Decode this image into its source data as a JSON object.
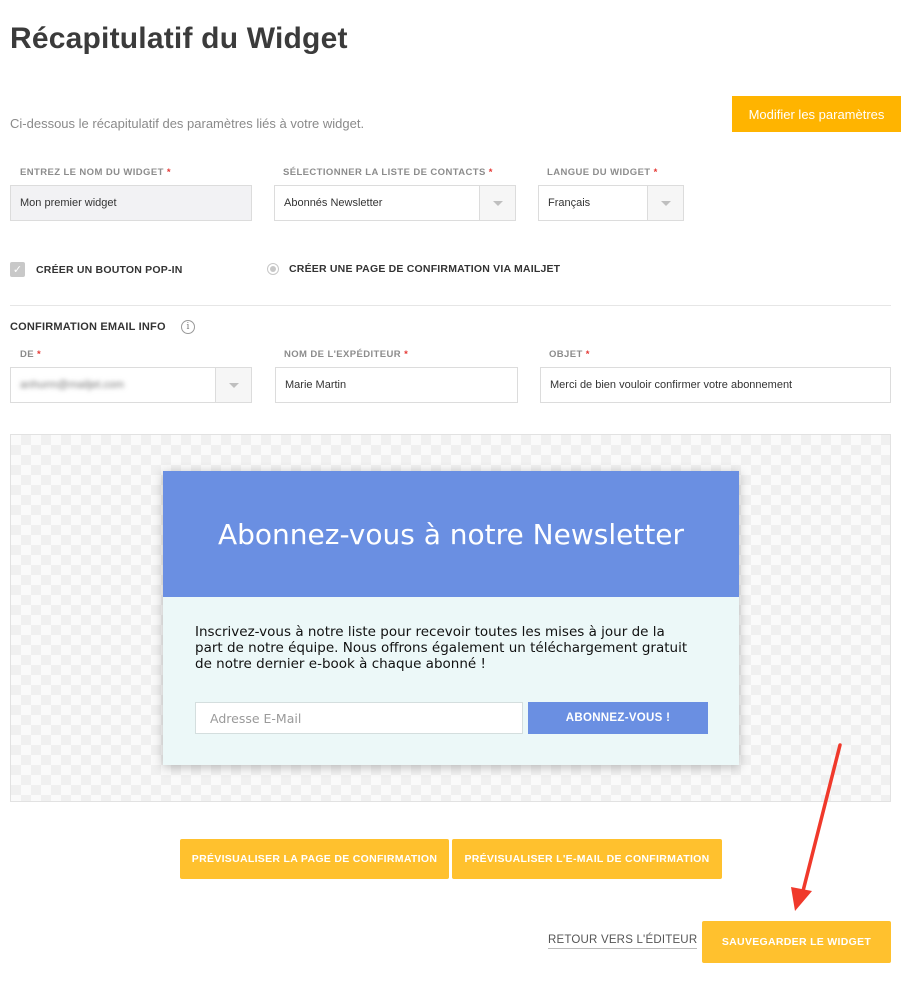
{
  "page": {
    "title": "Récapitulatif du Widget",
    "subtitle": "Ci-dessous le récapitulatif des paramètres liés à votre widget.",
    "modify_button": "Modifier les paramètres"
  },
  "fields": {
    "widget_name": {
      "label": "ENTREZ LE NOM DU WIDGET",
      "required": "*",
      "value": "Mon premier widget"
    },
    "contact_list": {
      "label": "SÉLECTIONNER LA LISTE DE CONTACTS",
      "required": "*",
      "value": "Abonnés Newsletter"
    },
    "language": {
      "label": "LANGUE DU WIDGET",
      "required": "*",
      "value": "Français"
    }
  },
  "options": {
    "popin": {
      "label": "CRÉER UN BOUTON POP-IN",
      "checked": true,
      "check_glyph": "✓"
    },
    "confirmation_page": {
      "label": "CRÉER UNE PAGE DE CONFIRMATION VIA MAILJET",
      "selected": false
    }
  },
  "confirmation": {
    "section_title": "CONFIRMATION EMAIL INFO",
    "info_glyph": "i",
    "from": {
      "label": "DE",
      "required": "*",
      "value": "anhurm@mailjet.com"
    },
    "sender_name": {
      "label": "NOM DE L'EXPÉDITEUR",
      "required": "*",
      "value": "Marie Martin"
    },
    "subject": {
      "label": "OBJET",
      "required": "*",
      "value": "Merci de bien vouloir confirmer votre abonnement"
    }
  },
  "widget_preview": {
    "title": "Abonnez-vous à notre Newsletter",
    "body": "Inscrivez-vous à notre liste pour recevoir toutes les mises à jour de la part de notre équipe. Nous offrons également un téléchargement gratuit de notre dernier e-book à chaque abonné !",
    "email_placeholder": "Adresse E-Mail",
    "subscribe_button": "ABONNEZ-VOUS !",
    "header_color": "#6a8fe2",
    "body_color": "#ecf8f8"
  },
  "actions": {
    "preview_page": "PRÉVISUALISER LA PAGE DE CONFIRMATION",
    "preview_email": "PRÉVISUALISER L'E-MAIL DE CONFIRMATION",
    "back": "RETOUR VERS L'ÉDITEUR",
    "save": "SAUVEGARDER LE WIDGET"
  },
  "colors": {
    "accent": "#ffb400",
    "button_yellow": "#ffc12e",
    "annotation_arrow": "#f0392b"
  }
}
